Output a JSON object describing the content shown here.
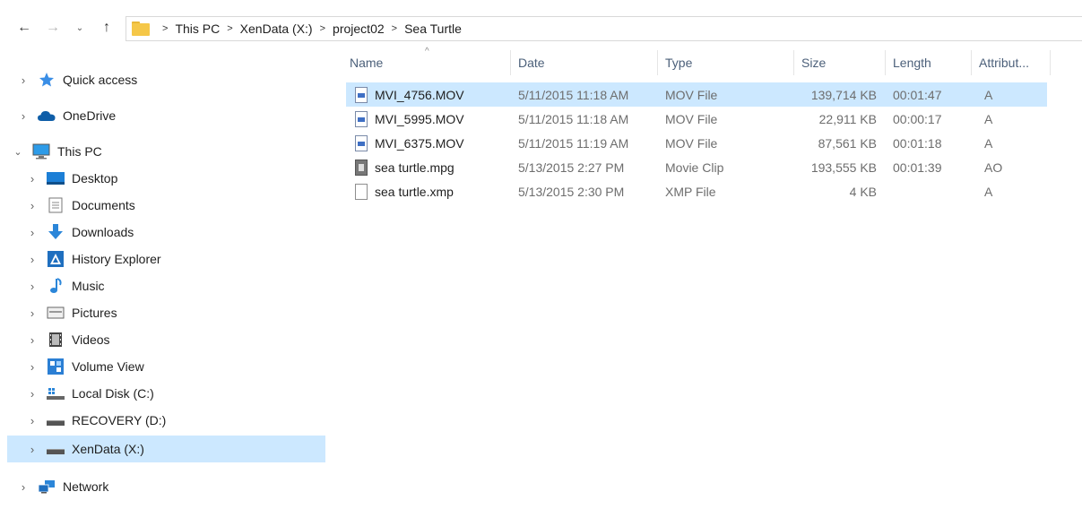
{
  "breadcrumb": [
    "This PC",
    "XenData (X:)",
    "project02",
    "Sea Turtle"
  ],
  "nav": {
    "back": "←",
    "forward": "→",
    "recent": "⌄",
    "up": "↑"
  },
  "sidebar": {
    "items": [
      {
        "label": "Quick access",
        "icon": "star-icon",
        "chevron": "›",
        "indent": 0
      },
      {
        "label": "OneDrive",
        "icon": "cloud-icon",
        "chevron": "›",
        "indent": 0
      },
      {
        "label": "This PC",
        "icon": "computer-icon",
        "chevron": "⌄",
        "indent": 0
      },
      {
        "label": "Desktop",
        "icon": "desktop-icon",
        "chevron": "›",
        "indent": 1
      },
      {
        "label": "Documents",
        "icon": "documents-icon",
        "chevron": "›",
        "indent": 1
      },
      {
        "label": "Downloads",
        "icon": "download-arrow-icon",
        "chevron": "›",
        "indent": 1
      },
      {
        "label": "History Explorer",
        "icon": "history-explorer-icon",
        "chevron": "›",
        "indent": 1
      },
      {
        "label": "Music",
        "icon": "music-note-icon",
        "chevron": "›",
        "indent": 1
      },
      {
        "label": "Pictures",
        "icon": "pictures-icon",
        "chevron": "›",
        "indent": 1
      },
      {
        "label": "Videos",
        "icon": "film-icon",
        "chevron": "›",
        "indent": 1
      },
      {
        "label": "Volume View",
        "icon": "volume-view-icon",
        "chevron": "›",
        "indent": 1
      },
      {
        "label": "Local Disk (C:)",
        "icon": "local-disk-icon",
        "chevron": "›",
        "indent": 1
      },
      {
        "label": "RECOVERY (D:)",
        "icon": "drive-icon",
        "chevron": "›",
        "indent": 1
      },
      {
        "label": "XenData (X:)",
        "icon": "drive-icon",
        "chevron": "›",
        "indent": 1,
        "selected": true
      },
      {
        "label": "Network",
        "icon": "network-icon",
        "chevron": "›",
        "indent": 0
      }
    ]
  },
  "columns": {
    "name": "Name",
    "date": "Date",
    "type": "Type",
    "size": "Size",
    "length": "Length",
    "attributes": "Attribut..."
  },
  "sort_indicator": "^",
  "files": [
    {
      "name": "MVI_4756.MOV",
      "date": "5/11/2015 11:18 AM",
      "type": "MOV File",
      "size": "139,714 KB",
      "length": "00:01:47",
      "attributes": "A",
      "icon": "video-file-icon",
      "selected": true
    },
    {
      "name": "MVI_5995.MOV",
      "date": "5/11/2015 11:18 AM",
      "type": "MOV File",
      "size": "22,911 KB",
      "length": "00:00:17",
      "attributes": "A",
      "icon": "video-file-icon"
    },
    {
      "name": "MVI_6375.MOV",
      "date": "5/11/2015 11:19 AM",
      "type": "MOV File",
      "size": "87,561 KB",
      "length": "00:01:18",
      "attributes": "A",
      "icon": "video-file-icon"
    },
    {
      "name": "sea turtle.mpg",
      "date": "5/13/2015 2:27 PM",
      "type": "Movie Clip",
      "size": "193,555 KB",
      "length": "00:01:39",
      "attributes": "AO",
      "icon": "movie-clip-icon"
    },
    {
      "name": "sea turtle.xmp",
      "date": "5/13/2015 2:30 PM",
      "type": "XMP File",
      "size": "4 KB",
      "length": "",
      "attributes": "A",
      "icon": "blank-file-icon"
    }
  ]
}
